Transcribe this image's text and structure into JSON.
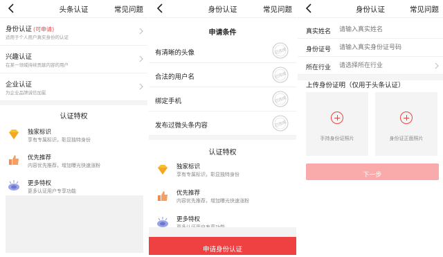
{
  "screen1": {
    "title": "头条认证",
    "faq": "常见问题",
    "items": [
      {
        "name": "身份认证",
        "tag": "(可申请)",
        "desc": "适用于个人用户真实身份的认证"
      },
      {
        "name": "兴趣认证",
        "tag": "",
        "desc": "在某一领域持续贡献内容的用户"
      },
      {
        "name": "企业认证",
        "tag": "",
        "desc": "为企业品牌诚信加冕"
      }
    ],
    "privileges_title": "认证特权",
    "privileges": [
      {
        "name": "独家标识",
        "desc": "享有专属标识，彰显独特身份",
        "icon": "diamond-icon"
      },
      {
        "name": "优先推荐",
        "desc": "内容优先推荐，增加曝光快速涨粉",
        "icon": "thumbs-up-icon"
      },
      {
        "name": "更多特权",
        "desc": "更多认证用户专享功能",
        "icon": "more-privileges-icon"
      }
    ]
  },
  "screen2": {
    "title": "身份认证",
    "faq": "常见问题",
    "conditions_title": "申请条件",
    "conditions": [
      {
        "name": "有清晰的头像",
        "stamp": "已完成"
      },
      {
        "name": "合法的用户名",
        "stamp": "已完成"
      },
      {
        "name": "绑定手机",
        "stamp": "已完成"
      },
      {
        "name": "发布过微头条内容",
        "stamp": "已完成"
      }
    ],
    "privileges_title": "认证特权",
    "privileges": [
      {
        "name": "独家标识",
        "desc": "享有专属标识，彰显独特身份",
        "icon": "diamond-icon"
      },
      {
        "name": "优先推荐",
        "desc": "内容优先推荐，增加曝光快速涨粉",
        "icon": "thumbs-up-icon"
      },
      {
        "name": "更多特权",
        "desc": "更多认证用户专享功能",
        "icon": "more-privileges-icon"
      }
    ],
    "apply_button": "申请身份认证"
  },
  "screen3": {
    "title": "身份认证",
    "faq": "常见问题",
    "fields": [
      {
        "label": "真实姓名",
        "placeholder": "请输入真实姓名"
      },
      {
        "label": "身份证号",
        "placeholder": "请输入真实身份证号码"
      },
      {
        "label": "所在行业",
        "placeholder": "请选择所在行业"
      }
    ],
    "upload_title": "上传身份证明（仅用于头条认证）",
    "uploads": [
      {
        "caption": "手持身份证照片"
      },
      {
        "caption": "身份证正面照片"
      }
    ],
    "next_button": "下一步"
  },
  "colors": {
    "accent": "#f04142",
    "accent_light": "#f9aaab",
    "grey_bg": "#f1f1f1"
  }
}
